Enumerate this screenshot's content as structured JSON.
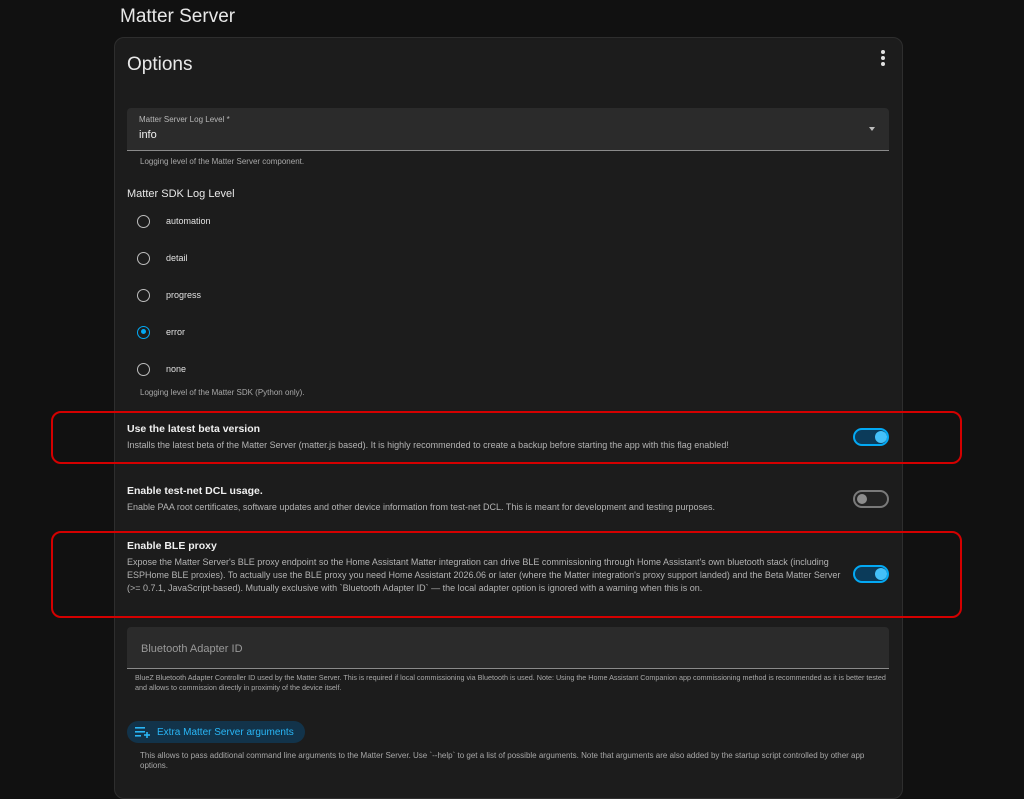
{
  "page": {
    "title": "Matter Server"
  },
  "card": {
    "title": "Options",
    "log_level": {
      "label": "Matter Server Log Level *",
      "value": "info",
      "helper": "Logging level of the Matter Server component."
    },
    "sdk_log_level": {
      "label": "Matter SDK Log Level",
      "options": [
        {
          "label": "automation",
          "checked": false
        },
        {
          "label": "detail",
          "checked": false
        },
        {
          "label": "progress",
          "checked": false
        },
        {
          "label": "error",
          "checked": true
        },
        {
          "label": "none",
          "checked": false
        }
      ],
      "helper": "Logging level of the Matter SDK (Python only)."
    },
    "beta": {
      "title": "Use the latest beta version",
      "description": "Installs the latest beta of the Matter Server (matter.js based). It is highly recommended to create a backup before starting the app with this flag enabled!",
      "enabled": true
    },
    "test_net": {
      "title": "Enable test-net DCL usage.",
      "description": "Enable PAA root certificates, software updates and other device information from test-net DCL. This is meant for development and testing purposes.",
      "enabled": false
    },
    "ble_proxy": {
      "title": "Enable BLE proxy",
      "description": "Expose the Matter Server's BLE proxy endpoint so the Home Assistant Matter integration can drive BLE commissioning through Home Assistant's own bluetooth stack (including ESPHome BLE proxies). To actually use the BLE proxy you need Home Assistant 2026.06 or later (where the Matter integration's proxy support landed) and the Beta Matter Server (>= 0.7.1, JavaScript-based). Mutually exclusive with `Bluetooth Adapter ID` — the local adapter option is ignored with a warning when this is on.",
      "enabled": true
    },
    "bluetooth_adapter": {
      "placeholder": "Bluetooth Adapter ID",
      "helper": "BlueZ Bluetooth Adapter Controller ID used by the Matter Server. This is required if local commissioning via Bluetooth is used. Note: Using the Home Assistant Companion app commissioning method is recommended as it is better tested and allows to commission directly in proximity of the device itself."
    },
    "extra_args": {
      "button_label": "Extra Matter Server arguments",
      "helper": "This allows to pass additional command line arguments to the Matter Server. Use `--help` to get a list of possible arguments. Note that arguments are also added by the startup script controlled by other app options."
    }
  },
  "colors": {
    "accent": "#03a9f4",
    "highlight": "#d40000",
    "background": "#111111",
    "card": "#1c1c1c"
  }
}
